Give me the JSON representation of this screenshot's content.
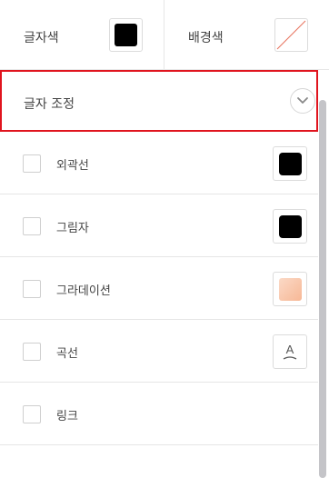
{
  "colors": {
    "text_color_label": "글자색",
    "text_color_value": "#000000",
    "bg_color_label": "배경색",
    "bg_color_value": "none"
  },
  "section": {
    "title": "글자 조정"
  },
  "items": [
    {
      "label": "외곽선",
      "swatch": "#000000"
    },
    {
      "label": "그림자",
      "swatch": "#000000"
    },
    {
      "label": "그라데이션",
      "swatch": "gradient-peach"
    },
    {
      "label": "곡선",
      "icon_text": "A"
    },
    {
      "label": "링크"
    }
  ],
  "accent": {
    "highlight_border": "#e0141e"
  }
}
